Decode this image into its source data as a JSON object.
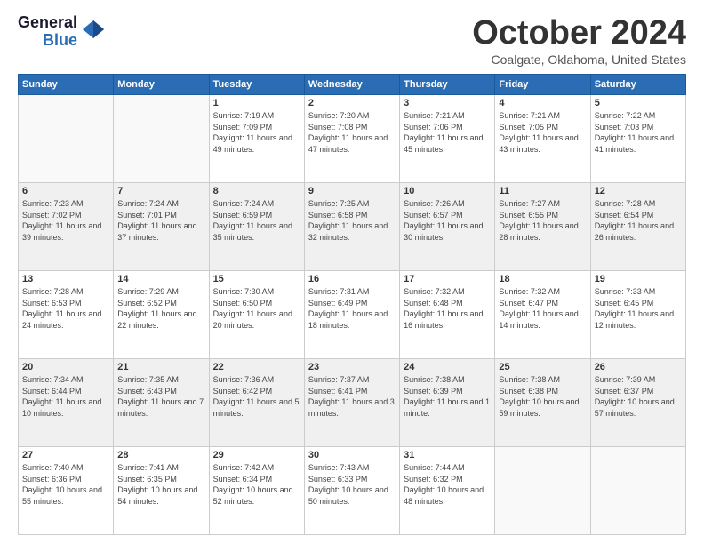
{
  "logo": {
    "line1": "General",
    "line2": "Blue"
  },
  "title": "October 2024",
  "location": "Coalgate, Oklahoma, United States",
  "weekdays": [
    "Sunday",
    "Monday",
    "Tuesday",
    "Wednesday",
    "Thursday",
    "Friday",
    "Saturday"
  ],
  "weeks": [
    [
      {
        "day": "",
        "sunrise": "",
        "sunset": "",
        "daylight": ""
      },
      {
        "day": "",
        "sunrise": "",
        "sunset": "",
        "daylight": ""
      },
      {
        "day": "1",
        "sunrise": "Sunrise: 7:19 AM",
        "sunset": "Sunset: 7:09 PM",
        "daylight": "Daylight: 11 hours and 49 minutes."
      },
      {
        "day": "2",
        "sunrise": "Sunrise: 7:20 AM",
        "sunset": "Sunset: 7:08 PM",
        "daylight": "Daylight: 11 hours and 47 minutes."
      },
      {
        "day": "3",
        "sunrise": "Sunrise: 7:21 AM",
        "sunset": "Sunset: 7:06 PM",
        "daylight": "Daylight: 11 hours and 45 minutes."
      },
      {
        "day": "4",
        "sunrise": "Sunrise: 7:21 AM",
        "sunset": "Sunset: 7:05 PM",
        "daylight": "Daylight: 11 hours and 43 minutes."
      },
      {
        "day": "5",
        "sunrise": "Sunrise: 7:22 AM",
        "sunset": "Sunset: 7:03 PM",
        "daylight": "Daylight: 11 hours and 41 minutes."
      }
    ],
    [
      {
        "day": "6",
        "sunrise": "Sunrise: 7:23 AM",
        "sunset": "Sunset: 7:02 PM",
        "daylight": "Daylight: 11 hours and 39 minutes."
      },
      {
        "day": "7",
        "sunrise": "Sunrise: 7:24 AM",
        "sunset": "Sunset: 7:01 PM",
        "daylight": "Daylight: 11 hours and 37 minutes."
      },
      {
        "day": "8",
        "sunrise": "Sunrise: 7:24 AM",
        "sunset": "Sunset: 6:59 PM",
        "daylight": "Daylight: 11 hours and 35 minutes."
      },
      {
        "day": "9",
        "sunrise": "Sunrise: 7:25 AM",
        "sunset": "Sunset: 6:58 PM",
        "daylight": "Daylight: 11 hours and 32 minutes."
      },
      {
        "day": "10",
        "sunrise": "Sunrise: 7:26 AM",
        "sunset": "Sunset: 6:57 PM",
        "daylight": "Daylight: 11 hours and 30 minutes."
      },
      {
        "day": "11",
        "sunrise": "Sunrise: 7:27 AM",
        "sunset": "Sunset: 6:55 PM",
        "daylight": "Daylight: 11 hours and 28 minutes."
      },
      {
        "day": "12",
        "sunrise": "Sunrise: 7:28 AM",
        "sunset": "Sunset: 6:54 PM",
        "daylight": "Daylight: 11 hours and 26 minutes."
      }
    ],
    [
      {
        "day": "13",
        "sunrise": "Sunrise: 7:28 AM",
        "sunset": "Sunset: 6:53 PM",
        "daylight": "Daylight: 11 hours and 24 minutes."
      },
      {
        "day": "14",
        "sunrise": "Sunrise: 7:29 AM",
        "sunset": "Sunset: 6:52 PM",
        "daylight": "Daylight: 11 hours and 22 minutes."
      },
      {
        "day": "15",
        "sunrise": "Sunrise: 7:30 AM",
        "sunset": "Sunset: 6:50 PM",
        "daylight": "Daylight: 11 hours and 20 minutes."
      },
      {
        "day": "16",
        "sunrise": "Sunrise: 7:31 AM",
        "sunset": "Sunset: 6:49 PM",
        "daylight": "Daylight: 11 hours and 18 minutes."
      },
      {
        "day": "17",
        "sunrise": "Sunrise: 7:32 AM",
        "sunset": "Sunset: 6:48 PM",
        "daylight": "Daylight: 11 hours and 16 minutes."
      },
      {
        "day": "18",
        "sunrise": "Sunrise: 7:32 AM",
        "sunset": "Sunset: 6:47 PM",
        "daylight": "Daylight: 11 hours and 14 minutes."
      },
      {
        "day": "19",
        "sunrise": "Sunrise: 7:33 AM",
        "sunset": "Sunset: 6:45 PM",
        "daylight": "Daylight: 11 hours and 12 minutes."
      }
    ],
    [
      {
        "day": "20",
        "sunrise": "Sunrise: 7:34 AM",
        "sunset": "Sunset: 6:44 PM",
        "daylight": "Daylight: 11 hours and 10 minutes."
      },
      {
        "day": "21",
        "sunrise": "Sunrise: 7:35 AM",
        "sunset": "Sunset: 6:43 PM",
        "daylight": "Daylight: 11 hours and 7 minutes."
      },
      {
        "day": "22",
        "sunrise": "Sunrise: 7:36 AM",
        "sunset": "Sunset: 6:42 PM",
        "daylight": "Daylight: 11 hours and 5 minutes."
      },
      {
        "day": "23",
        "sunrise": "Sunrise: 7:37 AM",
        "sunset": "Sunset: 6:41 PM",
        "daylight": "Daylight: 11 hours and 3 minutes."
      },
      {
        "day": "24",
        "sunrise": "Sunrise: 7:38 AM",
        "sunset": "Sunset: 6:39 PM",
        "daylight": "Daylight: 11 hours and 1 minute."
      },
      {
        "day": "25",
        "sunrise": "Sunrise: 7:38 AM",
        "sunset": "Sunset: 6:38 PM",
        "daylight": "Daylight: 10 hours and 59 minutes."
      },
      {
        "day": "26",
        "sunrise": "Sunrise: 7:39 AM",
        "sunset": "Sunset: 6:37 PM",
        "daylight": "Daylight: 10 hours and 57 minutes."
      }
    ],
    [
      {
        "day": "27",
        "sunrise": "Sunrise: 7:40 AM",
        "sunset": "Sunset: 6:36 PM",
        "daylight": "Daylight: 10 hours and 55 minutes."
      },
      {
        "day": "28",
        "sunrise": "Sunrise: 7:41 AM",
        "sunset": "Sunset: 6:35 PM",
        "daylight": "Daylight: 10 hours and 54 minutes."
      },
      {
        "day": "29",
        "sunrise": "Sunrise: 7:42 AM",
        "sunset": "Sunset: 6:34 PM",
        "daylight": "Daylight: 10 hours and 52 minutes."
      },
      {
        "day": "30",
        "sunrise": "Sunrise: 7:43 AM",
        "sunset": "Sunset: 6:33 PM",
        "daylight": "Daylight: 10 hours and 50 minutes."
      },
      {
        "day": "31",
        "sunrise": "Sunrise: 7:44 AM",
        "sunset": "Sunset: 6:32 PM",
        "daylight": "Daylight: 10 hours and 48 minutes."
      },
      {
        "day": "",
        "sunrise": "",
        "sunset": "",
        "daylight": ""
      },
      {
        "day": "",
        "sunrise": "",
        "sunset": "",
        "daylight": ""
      }
    ]
  ]
}
